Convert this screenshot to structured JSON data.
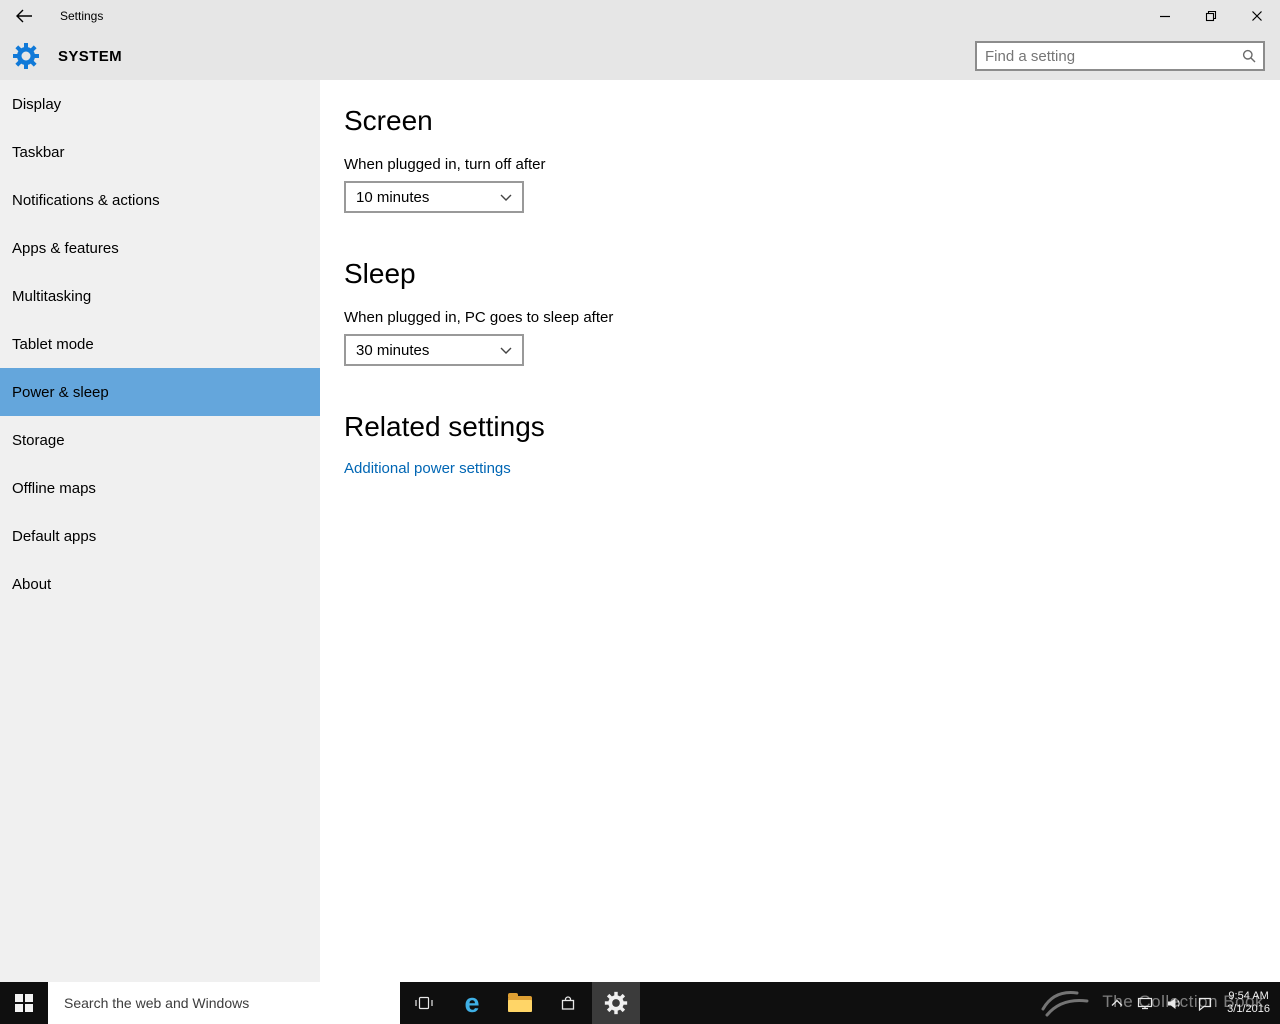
{
  "window": {
    "title": "Settings"
  },
  "header": {
    "page_title": "SYSTEM",
    "search": {
      "placeholder": "Find a setting"
    }
  },
  "sidebar": {
    "items": [
      {
        "label": "Display",
        "selected": false
      },
      {
        "label": "Taskbar",
        "selected": false
      },
      {
        "label": "Notifications & actions",
        "selected": false
      },
      {
        "label": "Apps & features",
        "selected": false
      },
      {
        "label": "Multitasking",
        "selected": false
      },
      {
        "label": "Tablet mode",
        "selected": false
      },
      {
        "label": "Power & sleep",
        "selected": true
      },
      {
        "label": "Storage",
        "selected": false
      },
      {
        "label": "Offline maps",
        "selected": false
      },
      {
        "label": "Default apps",
        "selected": false
      },
      {
        "label": "About",
        "selected": false
      }
    ]
  },
  "content": {
    "screen_section": {
      "heading": "Screen",
      "label": "When plugged in, turn off after",
      "value": "10 minutes"
    },
    "sleep_section": {
      "heading": "Sleep",
      "label": "When plugged in, PC goes to sleep after",
      "value": "30 minutes"
    },
    "related_section": {
      "heading": "Related settings",
      "link": "Additional power settings"
    }
  },
  "taskbar": {
    "search": {
      "placeholder": "Search the web and Windows"
    },
    "icons": {
      "edge_glyph": "e"
    },
    "clock": {
      "time": "9:54 AM",
      "date": "3/1/2016"
    }
  },
  "watermark": {
    "text": "The Collection Book"
  },
  "colors": {
    "accent_selected": "#64a6dc",
    "link": "#0066b4",
    "taskbar": "#0f0f0f",
    "chrome": "#e6e6e6"
  }
}
